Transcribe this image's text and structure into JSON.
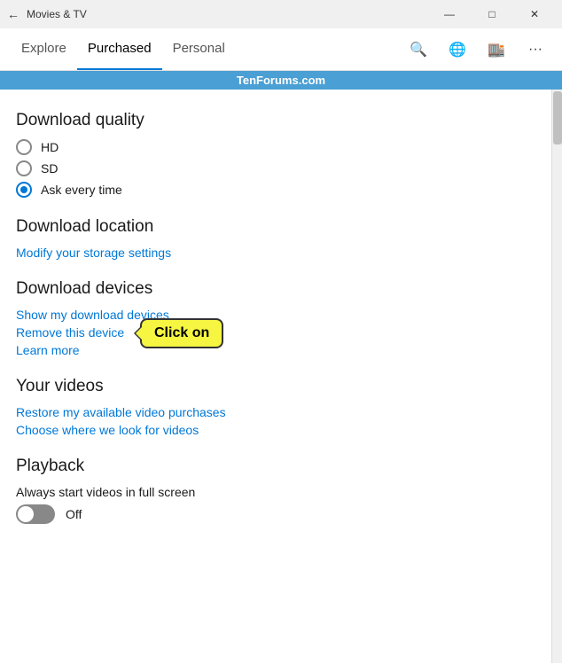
{
  "titlebar": {
    "title": "Movies & TV",
    "back_icon": "←",
    "minimize_icon": "—",
    "maximize_icon": "□",
    "close_icon": "✕"
  },
  "nav": {
    "tabs": [
      {
        "label": "Explore",
        "active": false
      },
      {
        "label": "Purchased",
        "active": true
      },
      {
        "label": "Personal",
        "active": false
      }
    ],
    "search_icon": "🔍",
    "account_icon": "👤",
    "store_icon": "🛍",
    "more_icon": "..."
  },
  "watermark": {
    "text": "TenForums.com"
  },
  "sections": {
    "download_quality": {
      "title": "Download quality",
      "options": [
        {
          "label": "HD",
          "checked": false
        },
        {
          "label": "SD",
          "checked": false
        },
        {
          "label": "Ask every time",
          "checked": true
        }
      ]
    },
    "download_location": {
      "title": "Download location",
      "link": "Modify your storage settings"
    },
    "download_devices": {
      "title": "Download devices",
      "links": [
        "Show my download devices",
        "Remove this device",
        "Learn more"
      ],
      "tooltip": "Click on"
    },
    "your_videos": {
      "title": "Your videos",
      "links": [
        "Restore my available video purchases",
        "Choose where we look for videos"
      ]
    },
    "playback": {
      "title": "Playback",
      "subtitle": "Always start videos in full screen",
      "toggle_state": "Off"
    }
  }
}
